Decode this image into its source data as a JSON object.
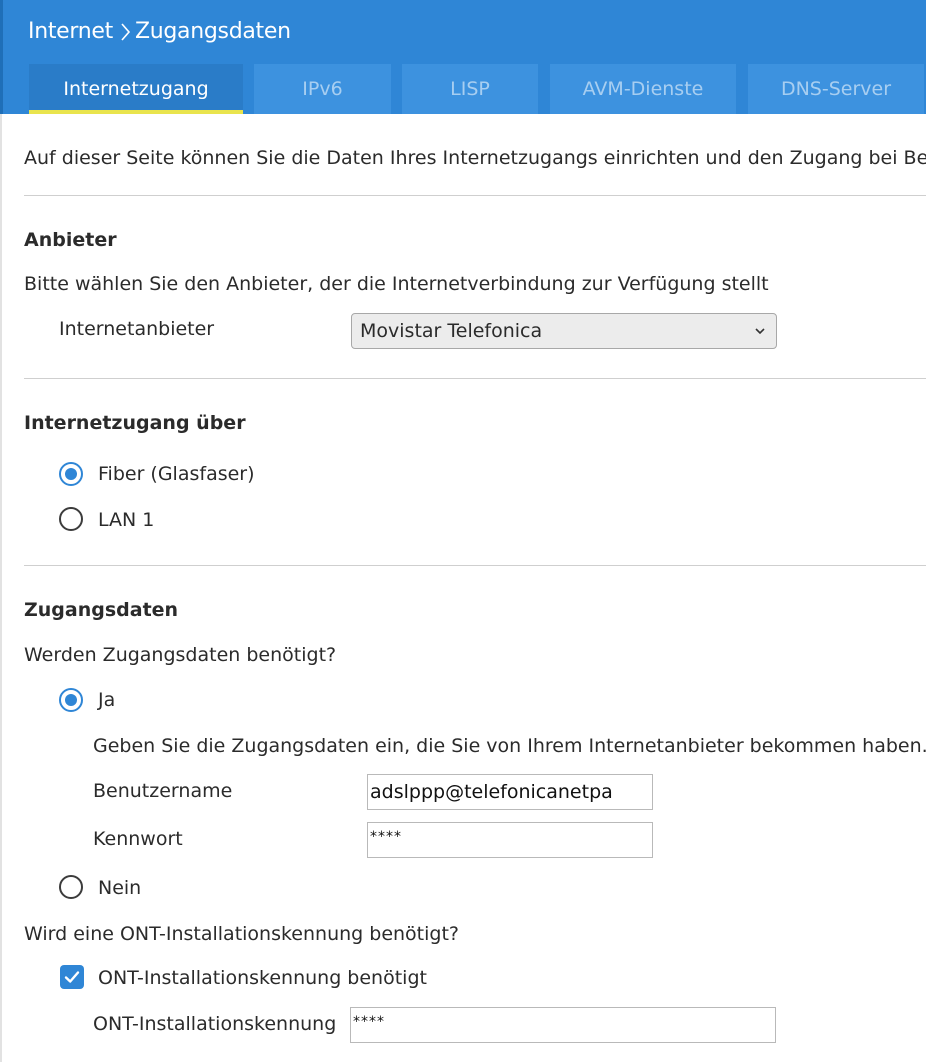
{
  "header": {
    "breadcrumb": {
      "parent": "Internet",
      "current": "Zugangsdaten"
    },
    "tabs": [
      {
        "label": "Internetzugang",
        "active": true
      },
      {
        "label": "IPv6",
        "active": false
      },
      {
        "label": "LISP",
        "active": false
      },
      {
        "label": "AVM-Dienste",
        "active": false
      },
      {
        "label": "DNS-Server",
        "active": false
      }
    ],
    "accent_color": "#2f86d6",
    "active_underline_color": "#e9e44d"
  },
  "intro_text": "Auf dieser Seite können Sie die Daten Ihres Internetzugangs einrichten und den Zugang bei Beda",
  "provider": {
    "heading": "Anbieter",
    "description": "Bitte wählen Sie den Anbieter, der die Internetverbindung zur Verfügung stellt",
    "field_label": "Internetanbieter",
    "selected": "Movistar Telefonica"
  },
  "access_via": {
    "heading": "Internetzugang über",
    "options": [
      {
        "label": "Fiber (Glasfaser)",
        "checked": true
      },
      {
        "label": "LAN 1",
        "checked": false
      }
    ]
  },
  "credentials": {
    "heading": "Zugangsdaten",
    "question": "Werden Zugangsdaten benötigt?",
    "yes_label": "Ja",
    "yes_checked": true,
    "yes_hint": "Geben Sie die Zugangsdaten ein, die Sie von Ihrem Internetanbieter bekommen haben.",
    "username_label": "Benutzername",
    "username_value": "adslppp@telefonicanetpa",
    "password_label": "Kennwort",
    "password_value": "****",
    "no_label": "Nein",
    "no_checked": false
  },
  "ont": {
    "question": "Wird eine ONT-Installationskennung benötigt?",
    "checkbox_label": "ONT-Installationskennung benötigt",
    "checkbox_checked": true,
    "field_label": "ONT-Installationskennung",
    "field_value": "****"
  }
}
